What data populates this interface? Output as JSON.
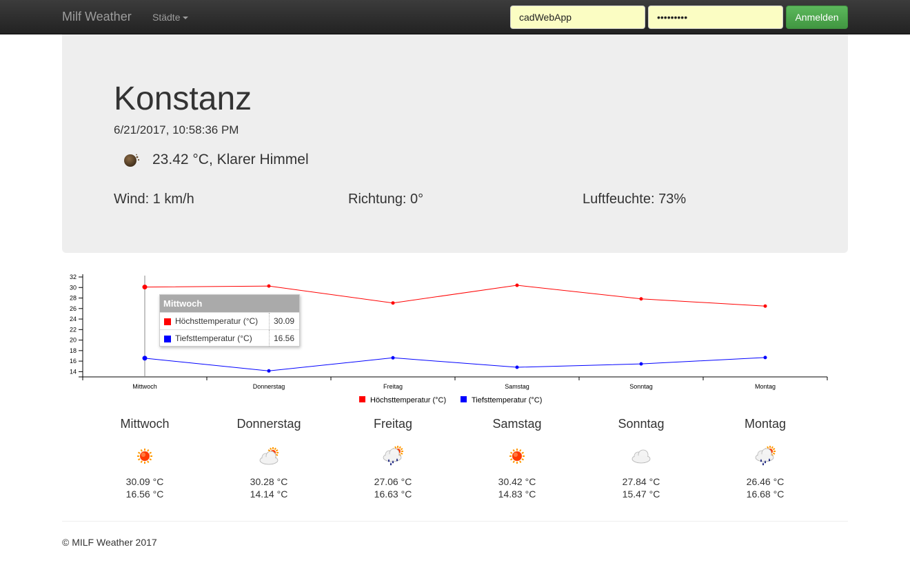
{
  "nav": {
    "brand": "Milf Weather",
    "cities_label": "Städte",
    "username_value": "cadWebApp",
    "password_value": "•••••••••",
    "login_label": "Anmelden"
  },
  "current": {
    "city": "Konstanz",
    "datetime": "6/21/2017, 10:58:36 PM",
    "icon": "moon-clear-icon",
    "summary": "23.42 °C, Klarer Himmel",
    "wind": "Wind: 1 km/h",
    "direction": "Richtung: 0°",
    "humidity": "Luftfeuchte: 73%"
  },
  "chart_data": {
    "type": "line",
    "categories": [
      "Mittwoch",
      "Donnerstag",
      "Freitag",
      "Samstag",
      "Sonntag",
      "Montag"
    ],
    "series": [
      {
        "name": "Höchsttemperatur (°C)",
        "color": "#ff0000",
        "values": [
          30.09,
          30.28,
          27.06,
          30.42,
          27.84,
          26.46
        ]
      },
      {
        "name": "Tiefsttemperatur (°C)",
        "color": "#0000ff",
        "values": [
          16.56,
          14.14,
          16.63,
          14.83,
          15.47,
          16.68
        ]
      }
    ],
    "y_ticks": [
      14,
      16,
      18,
      20,
      22,
      24,
      26,
      28,
      30,
      32
    ],
    "ylim": [
      13,
      32
    ],
    "legend": "bottom-center",
    "tooltip": {
      "title": "Mittwoch",
      "rows": [
        {
          "label": "Höchsttemperatur (°C)",
          "value": "30.09",
          "color": "#ff0000"
        },
        {
          "label": "Tiefsttemperatur (°C)",
          "value": "16.56",
          "color": "#0000ff"
        }
      ]
    }
  },
  "forecast": [
    {
      "day": "Mittwoch",
      "icon": "sun-icon",
      "high": "30.09 °C",
      "low": "16.56 °C"
    },
    {
      "day": "Donnerstag",
      "icon": "partly-cloudy-icon",
      "high": "30.28 °C",
      "low": "14.14 °C"
    },
    {
      "day": "Freitag",
      "icon": "rain-sun-icon",
      "high": "27.06 °C",
      "low": "16.63 °C"
    },
    {
      "day": "Samstag",
      "icon": "sun-icon",
      "high": "30.42 °C",
      "low": "14.83 °C"
    },
    {
      "day": "Sonntag",
      "icon": "cloud-icon",
      "high": "27.84 °C",
      "low": "15.47 °C"
    },
    {
      "day": "Montag",
      "icon": "rain-sun-icon",
      "high": "26.46 °C",
      "low": "16.68 °C"
    }
  ],
  "footer": "© MILF Weather 2017"
}
